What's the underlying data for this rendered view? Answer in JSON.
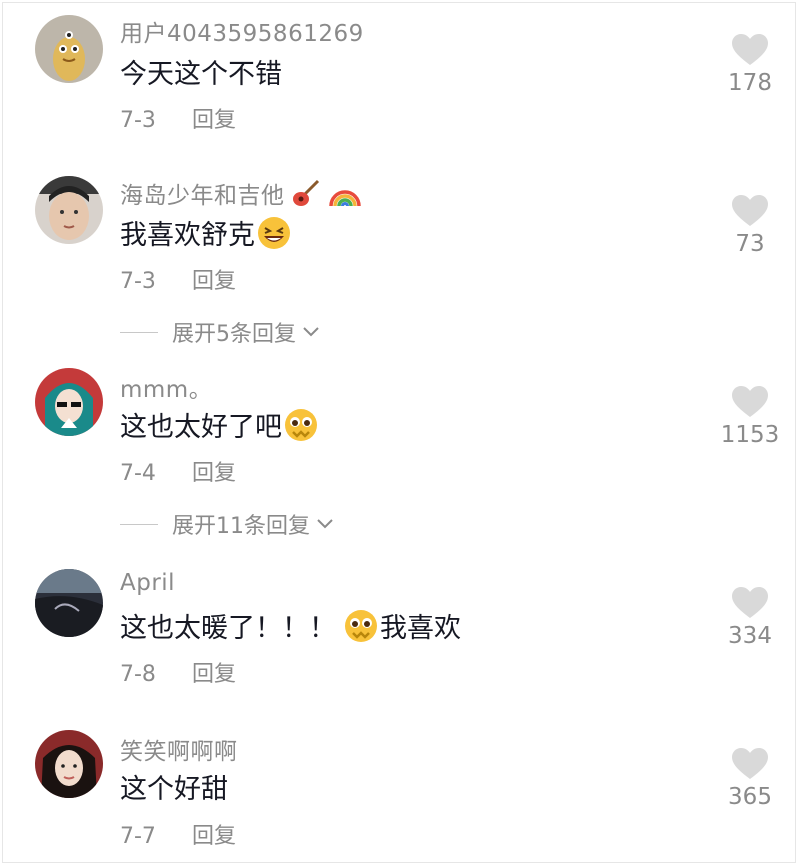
{
  "comments": [
    {
      "username": "用户4043595861269",
      "text": "今天这个不错",
      "emoji_after": "",
      "text_after": "",
      "date": "7-3",
      "reply_label": "回复",
      "likes": "178"
    },
    {
      "username": "海岛少年和吉他",
      "username_emojis": [
        "guitar-emoji",
        "rainbow-emoji"
      ],
      "text": "我喜欢舒克",
      "emoji_after": "laughing-emoji",
      "text_after": "",
      "date": "7-3",
      "reply_label": "回复",
      "likes": "73",
      "expand_label": "展开5条回复"
    },
    {
      "username": "mmm。",
      "text": "这也太好了吧",
      "emoji_after": "pleading-emoji",
      "text_after": "",
      "date": "7-4",
      "reply_label": "回复",
      "likes": "1153",
      "expand_label": "展开11条回复"
    },
    {
      "username": "April",
      "text": "这也太暖了！！！",
      "emoji_after": "pleading-emoji",
      "text_after": "我喜欢",
      "date": "7-8",
      "reply_label": "回复",
      "likes": "334"
    },
    {
      "username": "笑笑啊啊啊",
      "text": "这个好甜",
      "emoji_after": "",
      "text_after": "",
      "date": "7-7",
      "reply_label": "回复",
      "likes": "365"
    }
  ],
  "colors": {
    "secondary_text": "#8a8a8a",
    "primary_text": "#161823",
    "heart": "#d9d9d9"
  }
}
